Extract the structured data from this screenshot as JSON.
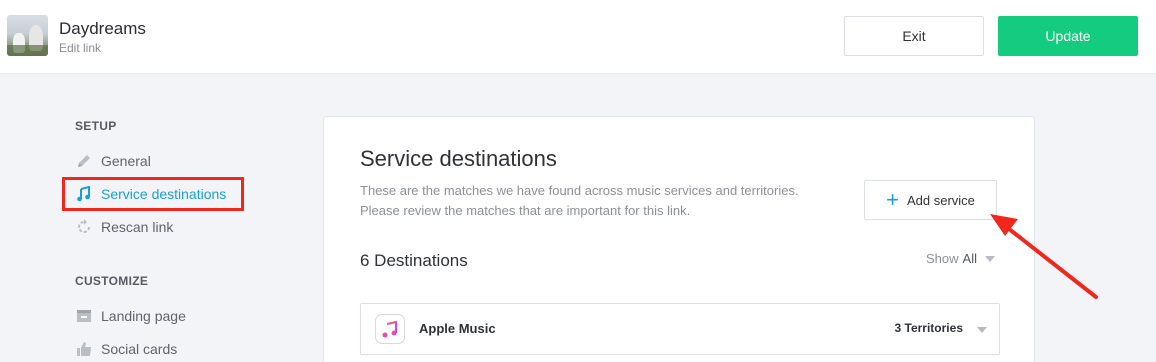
{
  "header": {
    "title": "Daydreams",
    "subtitle": "Edit link",
    "exit_label": "Exit",
    "update_label": "Update"
  },
  "sidebar": {
    "setup_heading": "SETUP",
    "setup_items": [
      {
        "label": "General",
        "icon": "pencil-icon"
      },
      {
        "label": "Service destinations",
        "icon": "music-note-icon",
        "active": true
      },
      {
        "label": "Rescan link",
        "icon": "refresh-icon"
      }
    ],
    "customize_heading": "CUSTOMIZE",
    "customize_items": [
      {
        "label": "Landing page",
        "icon": "landing-page-icon"
      },
      {
        "label": "Social cards",
        "icon": "thumbs-up-icon"
      }
    ]
  },
  "main": {
    "title": "Service destinations",
    "description": "These are the matches we have found across music services and territories. Please review the matches that are important for this link.",
    "add_service_label": "Add service",
    "destinations_count": "6 Destinations",
    "show_label": "Show",
    "show_value": "All",
    "destinations": [
      {
        "name": "Apple Music",
        "territories": "3 Territories",
        "icon": "apple-music-icon"
      }
    ]
  },
  "colors": {
    "accent": "#1aa0d8",
    "update_green": "#14cc7f",
    "annotation_red": "#f0271d"
  }
}
